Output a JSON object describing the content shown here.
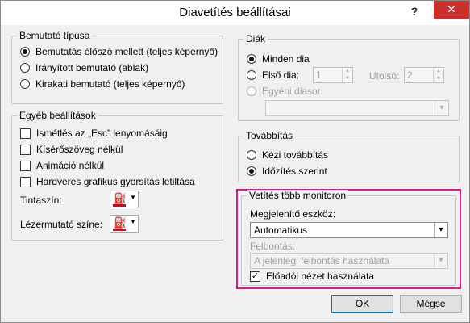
{
  "window": {
    "title": "Diavetítés beállításai",
    "help": "?",
    "close": "✕"
  },
  "show_type": {
    "legend": "Bemutató típusa",
    "options": [
      "Bemutatás élőszó mellett (teljes képernyő)",
      "Irányított bemutató (ablak)",
      "Kirakati bemutató (teljes képernyő)"
    ],
    "selected_index": 0
  },
  "options": {
    "legend": "Egyéb beállítások",
    "checkboxes": [
      {
        "label": "Ismétlés az „Esc” lenyomásáig",
        "checked": false
      },
      {
        "label": "Kísérőszöveg nélkül",
        "checked": false
      },
      {
        "label": "Animáció nélkül",
        "checked": false
      },
      {
        "label": "Hardveres grafikus gyorsítás letiltása",
        "checked": false
      }
    ],
    "pen_color_label": "Tintaszín:",
    "laser_color_label": "Lézermutató színe:",
    "pen_color": "#d9001b",
    "laser_color": "#d9001b"
  },
  "slides": {
    "legend": "Diák",
    "all_label": "Minden dia",
    "from_label": "Első dia:",
    "from_value": "1",
    "to_label": "Utolsó:",
    "to_value": "2",
    "custom_label": "Egyéni diasor:",
    "custom_value": ""
  },
  "advance": {
    "legend": "Továbbítás",
    "manual_label": "Kézi továbbítás",
    "timings_label": "Időzítés szerint",
    "selected": "timings"
  },
  "monitors": {
    "legend": "Vetítés több monitoron",
    "display_label": "Megjelenítő eszköz:",
    "display_value": "Automatikus",
    "resolution_label": "Felbontás:",
    "resolution_value": "A jelenlegi felbontás használata",
    "presenter_view_label": "Előadói nézet használata",
    "presenter_view_checked": true,
    "highlight_color": "#e0198a"
  },
  "buttons": {
    "ok": "OK",
    "cancel": "Mégse"
  },
  "icons": {
    "dropdown": "▾",
    "spin_up": "▲",
    "spin_down": "▼",
    "bucket": "⛽",
    "check": "✓"
  }
}
